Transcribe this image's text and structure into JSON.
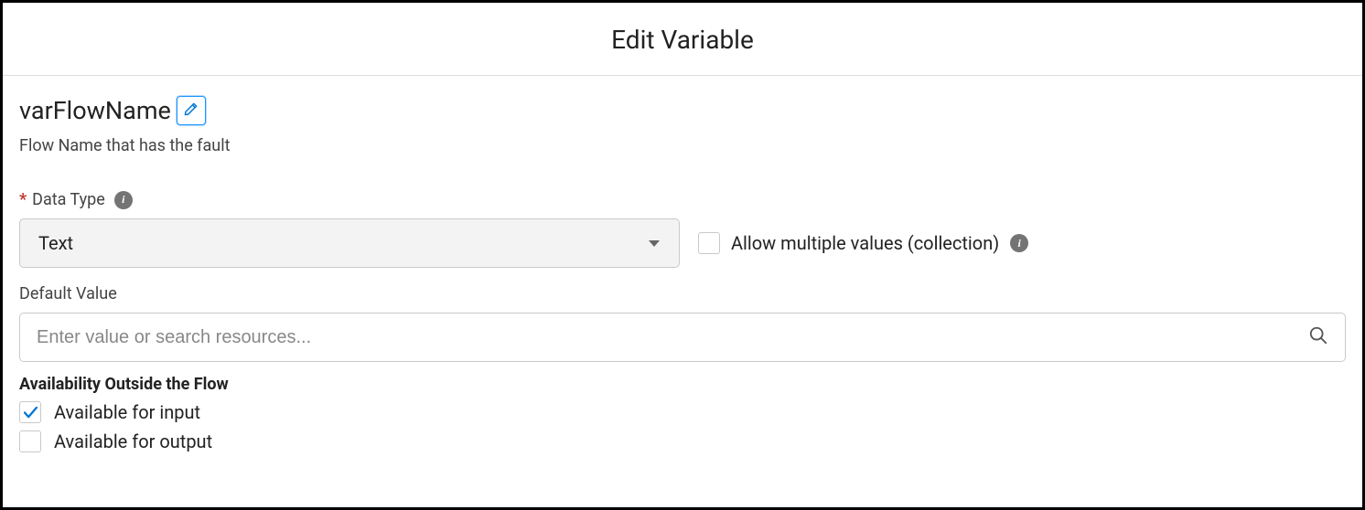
{
  "header": {
    "title": "Edit Variable"
  },
  "variable": {
    "name": "varFlowName",
    "description": "Flow Name that has the fault"
  },
  "dataType": {
    "label": "Data Type",
    "value": "Text",
    "required": true
  },
  "allowMultiple": {
    "label": "Allow multiple values (collection)",
    "checked": false
  },
  "defaultValue": {
    "label": "Default Value",
    "placeholder": "Enter value or search resources...",
    "value": ""
  },
  "availability": {
    "title": "Availability Outside the Flow",
    "input": {
      "label": "Available for input",
      "checked": true
    },
    "output": {
      "label": "Available for output",
      "checked": false
    }
  }
}
